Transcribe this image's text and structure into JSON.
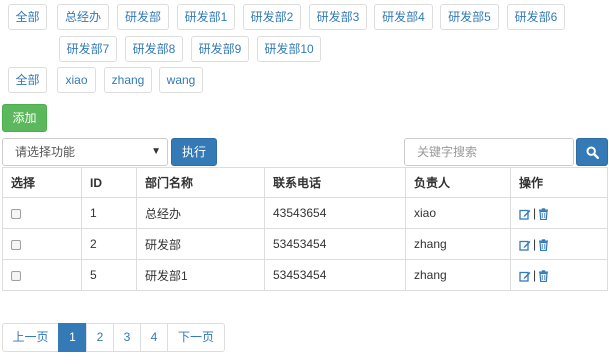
{
  "filters": {
    "departments": [
      "全部",
      "总经办",
      "研发部",
      "研发部1",
      "研发部2",
      "研发部3",
      "研发部4",
      "研发部5",
      "研发部6",
      "研发部7",
      "研发部8",
      "研发部9",
      "研发部10"
    ],
    "users": [
      "全部",
      "xiao",
      "zhang",
      "wang"
    ]
  },
  "toolbar": {
    "add_label": "添加",
    "select_placeholder": "请选择功能",
    "execute_label": "执行",
    "search_placeholder": "关键字搜索"
  },
  "table": {
    "columns": [
      "选择",
      "ID",
      "部门名称",
      "联系电话",
      "负责人",
      "操作"
    ],
    "rows": [
      {
        "id": "1",
        "name": "总经办",
        "phone": "43543654",
        "owner": "xiao",
        "op_sep": "|"
      },
      {
        "id": "2",
        "name": "研发部",
        "phone": "53453454",
        "owner": "zhang",
        "op_sep": "|"
      },
      {
        "id": "5",
        "name": "研发部1",
        "phone": "53453454",
        "owner": "zhang",
        "op_sep": "|"
      }
    ]
  },
  "pagination": {
    "prev_label": "上一页",
    "pages": [
      "1",
      "2",
      "3",
      "4"
    ],
    "current": "1",
    "next_label": "下一页"
  },
  "icons": {
    "search": "search-icon",
    "edit": "edit-icon",
    "delete": "trash-icon",
    "caret": "caret-down-icon"
  },
  "colors": {
    "primary": "#337ab7",
    "success": "#5cb85c",
    "border": "#dddddd"
  }
}
